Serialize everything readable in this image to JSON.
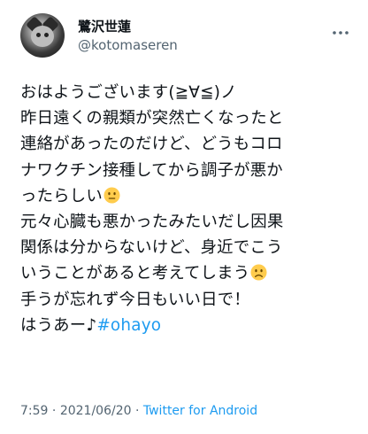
{
  "author": {
    "display_name": "鷺沢世蓮",
    "handle": "@kotomaseren"
  },
  "tweet": {
    "lines": [
      "おはようございます(≧∀≦)ノ",
      "昨日遠くの親類が突然亡くなったと",
      "連絡があったのだけど、どうもコロ",
      "ナワクチン接種してから調子が悪か",
      "ったらしい",
      "元々心臓も悪かったみたいだし因果",
      "関係は分からないけど、身近でこう",
      "いうことがあると考えてしまう",
      "手うが忘れず今日もいい日で！",
      "はうあー♪"
    ],
    "hashtag": "#ohayo",
    "emojis": {
      "line5": "neutral-face-emoji",
      "line8": "frowning-face-emoji"
    }
  },
  "meta": {
    "time": "7:59",
    "separator1": " · ",
    "date": "2021/06/20",
    "separator2": " · ",
    "source": "Twitter for Android"
  },
  "colors": {
    "text": "#0f1419",
    "secondary": "#536471",
    "link": "#1d9bf0",
    "emoji": "#ffcc4d"
  },
  "icons": {
    "more": "more-horizontal-icon"
  }
}
